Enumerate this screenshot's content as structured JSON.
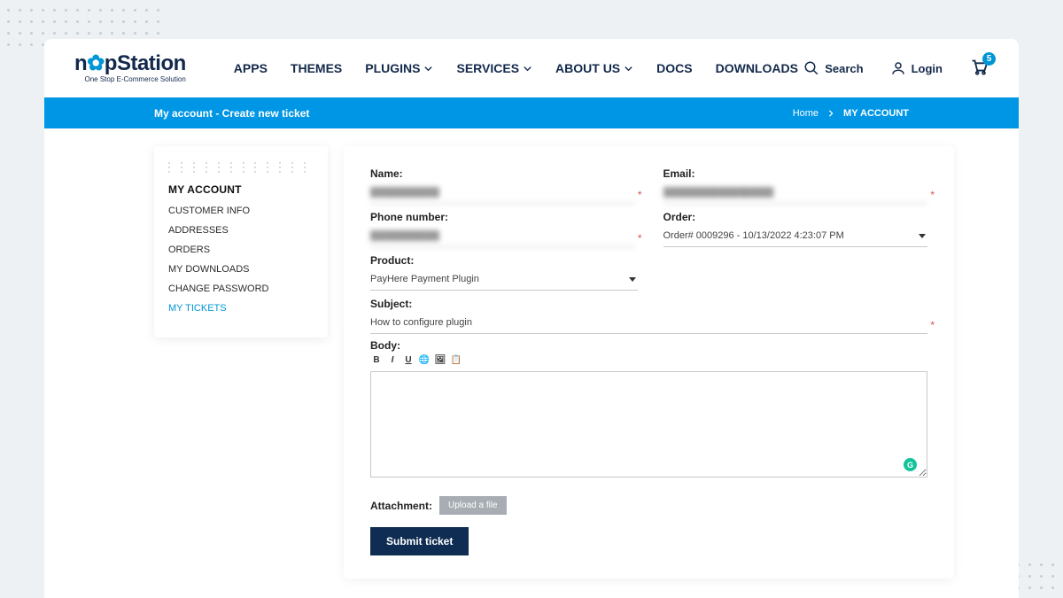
{
  "logo": {
    "text_left": "n",
    "text_accent": "o",
    "text_right": "pStation",
    "tagline": "One Stop E-Commerce Solution"
  },
  "nav": {
    "apps": "APPS",
    "themes": "THEMES",
    "plugins": "PLUGINS",
    "services": "SERVICES",
    "about": "ABOUT US",
    "docs": "DOCS",
    "downloads": "DOWNLOADS"
  },
  "header_actions": {
    "search": "Search",
    "login": "Login",
    "cart_count": "5"
  },
  "blue_bar": {
    "title": "My account - Create new ticket",
    "home": "Home",
    "current": "MY ACCOUNT"
  },
  "sidebar": {
    "title": "MY ACCOUNT",
    "items": [
      "CUSTOMER INFO",
      "ADDRESSES",
      "ORDERS",
      "MY DOWNLOADS",
      "CHANGE PASSWORD",
      "MY TICKETS"
    ]
  },
  "form": {
    "name_label": "Name:",
    "name_value": "██████████",
    "email_label": "Email:",
    "email_value": "████████████████",
    "phone_label": "Phone number:",
    "phone_value": "██████████",
    "order_label": "Order:",
    "order_value": "Order# 0009296 - 10/13/2022 4:23:07 PM",
    "product_label": "Product:",
    "product_value": "PayHere Payment Plugin",
    "subject_label": "Subject:",
    "subject_value": "How to configure plugin",
    "body_label": "Body:",
    "attachment_label": "Attachment:",
    "upload_label": "Upload a file",
    "submit_label": "Submit ticket"
  }
}
